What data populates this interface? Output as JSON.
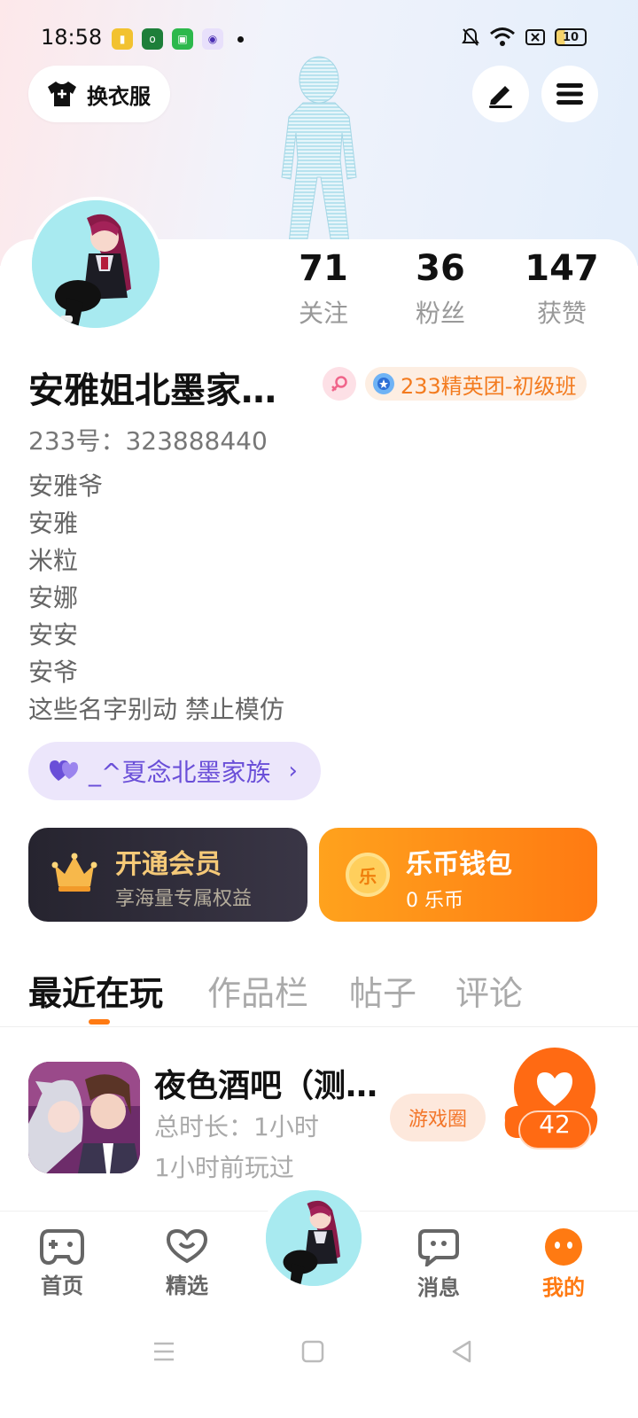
{
  "status_bar": {
    "time": "18:58",
    "battery": "10"
  },
  "toolbar": {
    "dress_label": "换衣服"
  },
  "profile": {
    "stats": [
      {
        "value": "71",
        "label": "关注"
      },
      {
        "value": "36",
        "label": "粉丝"
      },
      {
        "value": "147",
        "label": "获赞"
      }
    ],
    "nickname": "安雅姐北墨家…",
    "elite_badge": "233精英团-初级班",
    "uid": "233号：323888440",
    "bio": [
      "安雅爷",
      "安雅",
      "米粒",
      "安娜",
      "安安",
      "安爷",
      "这些名字别动 禁止模仿"
    ],
    "family": "_^夏念北墨家族"
  },
  "vip": {
    "title": "开通会员",
    "subtitle": "享海量专属权益"
  },
  "wallet": {
    "coin_char": "乐",
    "title": "乐币钱包",
    "subtitle": "0 乐币"
  },
  "tabs": [
    "最近在玩",
    "作品栏",
    "帖子",
    "评论"
  ],
  "game": {
    "title": "夜色酒吧（测…",
    "duration": "总时长：1小时",
    "last_played": "1小时前玩过",
    "circle_label": "游戏圈",
    "likes": "42"
  },
  "bottom_nav": [
    {
      "label": "首页",
      "icon": "gamepad-icon"
    },
    {
      "label": "精选",
      "icon": "heart-icon"
    },
    {
      "label": "消息",
      "icon": "chat-icon"
    },
    {
      "label": "我的",
      "icon": "smile-icon"
    }
  ],
  "colors": {
    "accent": "#ff7a12",
    "vip_gold": "#f5c978",
    "family_purple": "#6a4fd8"
  }
}
